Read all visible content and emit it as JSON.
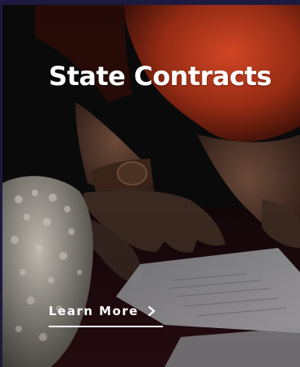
{
  "card": {
    "title": "State Contracts",
    "cta_label": "Learn More",
    "cta_icon": "chevron-right-icon"
  },
  "colors": {
    "frame": "#1d1a3f",
    "text": "#ffffff",
    "sleeve": "#b8381f"
  }
}
